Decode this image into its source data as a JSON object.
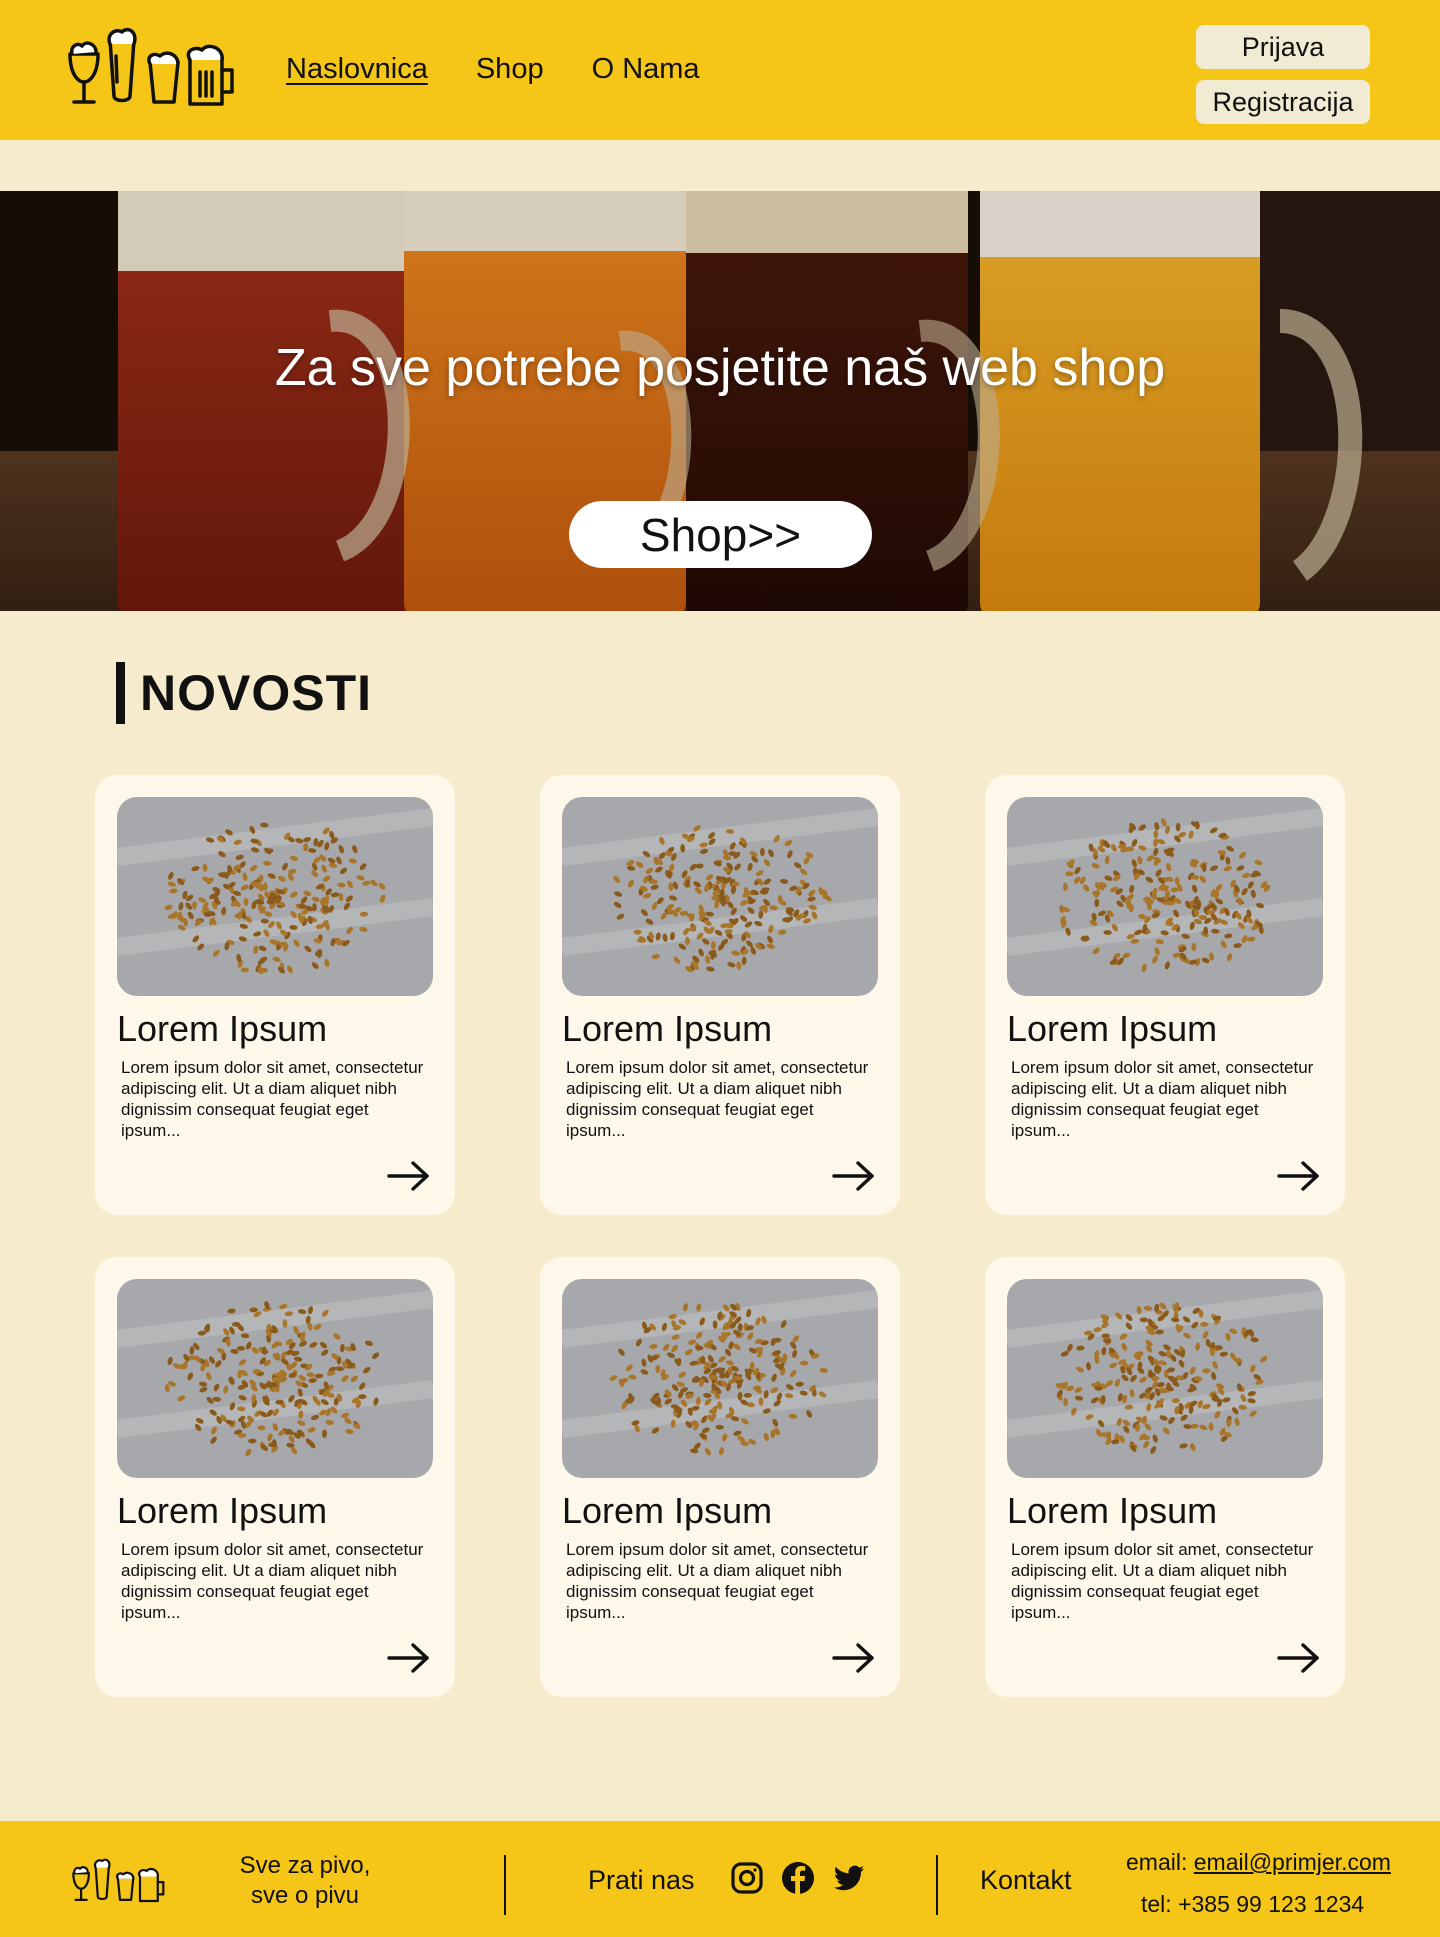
{
  "nav": {
    "items": [
      {
        "label": "Naslovnica",
        "active": true
      },
      {
        "label": "Shop",
        "active": false
      },
      {
        "label": "O Nama",
        "active": false
      }
    ]
  },
  "auth": {
    "login_label": "Prijava",
    "register_label": "Registracija"
  },
  "hero": {
    "title": "Za sve potrebe posjetite naš web shop",
    "button_label": "Shop>>"
  },
  "news": {
    "heading": "NOVOSTI",
    "cards": [
      {
        "title": "Lorem Ipsum",
        "text": "Lorem ipsum dolor sit amet, consectetur adipiscing elit. Ut a diam aliquet nibh dignissim consequat feugiat eget ipsum..."
      },
      {
        "title": "Lorem Ipsum",
        "text": "Lorem ipsum dolor sit amet, consectetur adipiscing elit. Ut a diam aliquet nibh dignissim consequat feugiat eget ipsum..."
      },
      {
        "title": "Lorem Ipsum",
        "text": "Lorem ipsum dolor sit amet, consectetur adipiscing elit. Ut a diam aliquet nibh dignissim consequat feugiat eget ipsum..."
      },
      {
        "title": "Lorem Ipsum",
        "text": "Lorem ipsum dolor sit amet, consectetur adipiscing elit. Ut a diam aliquet nibh dignissim consequat feugiat eget ipsum..."
      },
      {
        "title": "Lorem Ipsum",
        "text": "Lorem ipsum dolor sit amet, consectetur adipiscing elit. Ut a diam aliquet nibh dignissim consequat feugiat eget ipsum..."
      },
      {
        "title": "Lorem Ipsum",
        "text": "Lorem ipsum dolor sit amet, consectetur adipiscing elit. Ut a diam aliquet nibh dignissim consequat feugiat eget ipsum..."
      }
    ]
  },
  "footer": {
    "tagline_line1": "Sve za pivo,",
    "tagline_line2": "sve o pivu",
    "follow_label": "Prati nas",
    "social_icons": [
      "instagram-icon",
      "facebook-icon",
      "twitter-icon"
    ],
    "contact_label": "Kontakt",
    "email_prefix": "email: ",
    "email": "email@primjer.com",
    "tel": "tel: +385 99 123 1234"
  },
  "colors": {
    "header_yellow": "#f5c518",
    "page_bg": "#f6ebcd",
    "card_bg": "#fdf8e9",
    "button_bg": "#f1ebd3"
  }
}
